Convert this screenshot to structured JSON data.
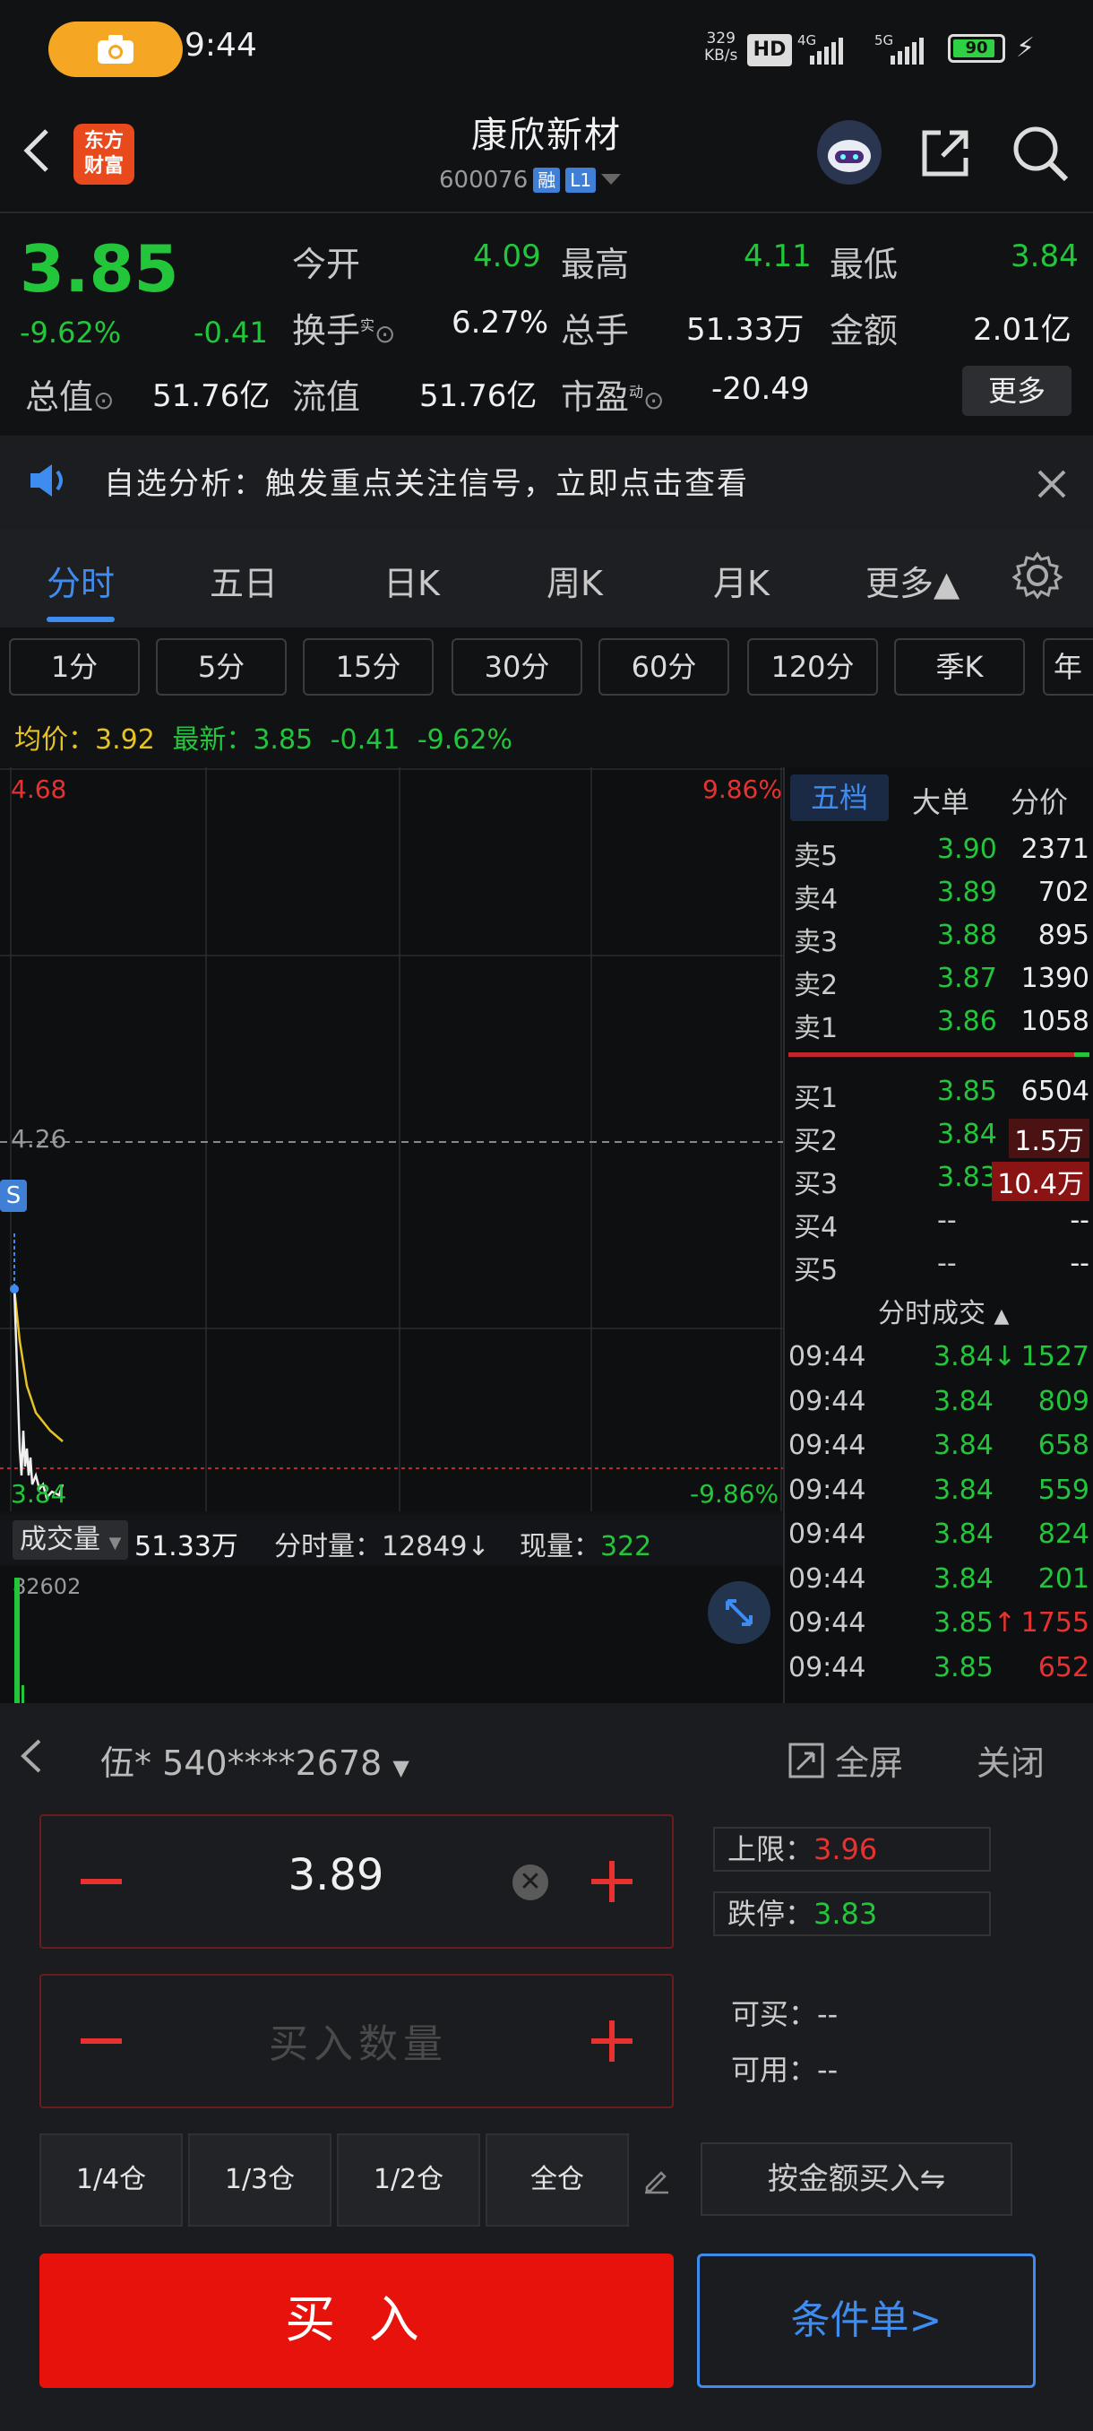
{
  "status": {
    "time": "9:44",
    "net_speed": "329\nKB/s",
    "hd": "HD",
    "net4g": "4G",
    "net5g": "5G",
    "battery": "90",
    "battery_level": 0.9
  },
  "header": {
    "logo_line1": "东方",
    "logo_line2": "财富",
    "stock_name": "康欣新材",
    "stock_code": "600076",
    "tag_rong": "融",
    "tag_l1": "L1"
  },
  "quote": {
    "price": "3.85",
    "change_pct": "-9.62%",
    "change": "-0.41",
    "open_label": "今开",
    "open": "4.09",
    "high_label": "最高",
    "high": "4.11",
    "low_label": "最低",
    "low": "3.84",
    "turnover_label": "换手",
    "turnover_sup": "实",
    "turnover": "6.27%",
    "volume_label": "总手",
    "volume": "51.33万",
    "amount_label": "金额",
    "amount": "2.01亿",
    "mktcap_label": "总值",
    "mktcap": "51.76亿",
    "float_label": "流值",
    "float": "51.76亿",
    "pe_label": "市盈",
    "pe_sup": "动",
    "pe": "-20.49",
    "more": "更多"
  },
  "notice": {
    "text": "自选分析：触发重点关注信号，立即点击查看"
  },
  "tabs": [
    "分时",
    "五日",
    "日K",
    "周K",
    "月K",
    "更多▲"
  ],
  "intervals": [
    "1分",
    "5分",
    "15分",
    "30分",
    "60分",
    "120分",
    "季K",
    "年"
  ],
  "avg_line": {
    "avg_label": "均价：",
    "avg": "3.92",
    "latest_label": "最新：",
    "latest": "3.85",
    "chg": "-0.41",
    "pct": "-9.62%"
  },
  "chart_labels": {
    "top_price": "4.68",
    "top_pct": "9.86%",
    "mid_price": "4.26",
    "bottom_price": "3.84",
    "bottom_pct": "-9.86%",
    "s_marker": "S"
  },
  "volume_bar": {
    "label": "成交量",
    "total": "51.33万",
    "minute_label": "分时量：",
    "minute": "12849↓",
    "now_label": "现量：",
    "now": "322",
    "axis_max": "82602"
  },
  "orderbook": {
    "tabs": [
      "五档",
      "大单",
      "分价"
    ],
    "asks": [
      {
        "label": "卖5",
        "price": "3.90",
        "vol": "2371"
      },
      {
        "label": "卖4",
        "price": "3.89",
        "vol": "702"
      },
      {
        "label": "卖3",
        "price": "3.88",
        "vol": "895"
      },
      {
        "label": "卖2",
        "price": "3.87",
        "vol": "1390"
      },
      {
        "label": "卖1",
        "price": "3.86",
        "vol": "1058"
      }
    ],
    "bids": [
      {
        "label": "买1",
        "price": "3.85",
        "vol": "6504"
      },
      {
        "label": "买2",
        "price": "3.84",
        "vol": "1.5万"
      },
      {
        "label": "买3",
        "price": "3.83",
        "vol": "10.4万"
      },
      {
        "label": "买4",
        "price": "--",
        "vol": "--"
      },
      {
        "label": "买5",
        "price": "--",
        "vol": "--"
      }
    ],
    "trades_title": "分时成交",
    "trades": [
      {
        "time": "09:44",
        "price": "3.84↓",
        "vol": "1527",
        "dir": "sell"
      },
      {
        "time": "09:44",
        "price": "3.84",
        "vol": "809",
        "dir": "sell"
      },
      {
        "time": "09:44",
        "price": "3.84",
        "vol": "658",
        "dir": "sell"
      },
      {
        "time": "09:44",
        "price": "3.84",
        "vol": "559",
        "dir": "sell"
      },
      {
        "time": "09:44",
        "price": "3.84",
        "vol": "824",
        "dir": "sell"
      },
      {
        "time": "09:44",
        "price": "3.84",
        "vol": "201",
        "dir": "sell"
      },
      {
        "time": "09:44",
        "price": "3.85↑",
        "vol": "1755",
        "dir": "buy"
      },
      {
        "time": "09:44",
        "price": "3.85",
        "vol": "652",
        "dir": "buy"
      }
    ]
  },
  "trade_panel": {
    "account": "伍* 540****2678",
    "fullscreen": "全屏",
    "close": "关闭",
    "price_value": "3.89",
    "qty_placeholder": "买入数量",
    "upper_label": "上限：",
    "upper": "3.96",
    "lower_label": "跌停：",
    "lower": "3.83",
    "can_buy_label": "可买：",
    "can_buy": "--",
    "available_label": "可用：",
    "available": "--",
    "positions": [
      "1/4仓",
      "1/3仓",
      "1/2仓",
      "全仓"
    ],
    "by_amount": "按金额买入⇋",
    "buy": "买 入",
    "conditional": "条件单>"
  },
  "colors": {
    "up": "#e8322f",
    "down": "#23c63a",
    "accent": "#3f8cf0",
    "buy_button": "#e8120c"
  }
}
